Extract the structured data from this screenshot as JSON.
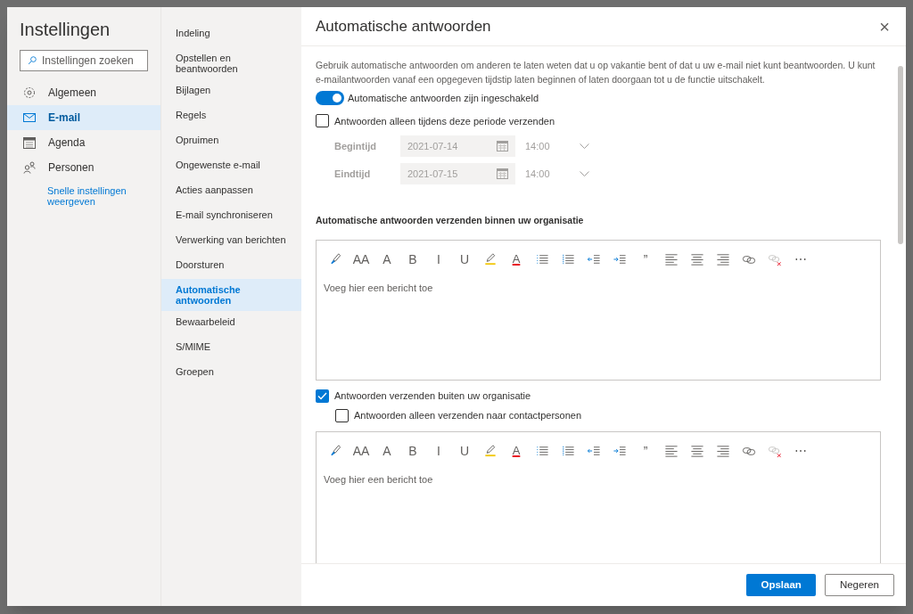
{
  "settings": {
    "title": "Instellingen",
    "search": {
      "placeholder": "Instellingen zoeken"
    },
    "categories": [
      {
        "label": "Algemeen",
        "kind": "gear",
        "selected": false
      },
      {
        "label": "E-mail",
        "kind": "mail",
        "selected": true
      },
      {
        "label": "Agenda",
        "kind": "calendar",
        "selected": false
      },
      {
        "label": "Personen",
        "kind": "people",
        "selected": false
      }
    ],
    "quick_link": "Snelle instellingen weergeven"
  },
  "subnav": [
    {
      "label": "Indeling",
      "selected": false
    },
    {
      "label": "Opstellen en beantwoorden",
      "selected": false
    },
    {
      "label": "Bijlagen",
      "selected": false
    },
    {
      "label": "Regels",
      "selected": false
    },
    {
      "label": "Opruimen",
      "selected": false
    },
    {
      "label": "Ongewenste e-mail",
      "selected": false
    },
    {
      "label": "Acties aanpassen",
      "selected": false
    },
    {
      "label": "E-mail synchroniseren",
      "selected": false
    },
    {
      "label": "Verwerking van berichten",
      "selected": false
    },
    {
      "label": "Doorsturen",
      "selected": false
    },
    {
      "label": "Automatische antwoorden",
      "selected": true
    },
    {
      "label": "Bewaarbeleid",
      "selected": false
    },
    {
      "label": "S/MIME",
      "selected": false
    },
    {
      "label": "Groepen",
      "selected": false
    }
  ],
  "panel": {
    "title": "Automatische antwoorden",
    "close": "×",
    "description": "Gebruik automatische antwoorden om anderen te laten weten dat u op vakantie bent of dat u uw e-mail niet kunt beantwoorden. U kunt e-mailantwoorden vanaf een opgegeven tijdstip laten beginnen of laten doorgaan tot u de functie uitschakelt.",
    "toggle": {
      "label": "Automatische antwoorden zijn ingeschakeld",
      "on": true
    },
    "period": {
      "label": "Antwoorden alleen tijdens deze periode verzenden",
      "checked": false
    },
    "times": [
      {
        "label": "Begintijd",
        "date": "2021-07-14",
        "time": "14:00",
        "disabled": true
      },
      {
        "label": "Eindtijd",
        "date": "2021-07-15",
        "time": "14:00",
        "disabled": true
      }
    ],
    "inside_heading": "Automatische antwoorden verzenden binnen uw organisatie",
    "editors": [
      {
        "placeholder": "Voeg hier een bericht toe",
        "toolbar": [
          {
            "kind": "brush"
          },
          {
            "kind": "glyph",
            "text": "AA"
          },
          {
            "kind": "glyph",
            "text": "A"
          },
          {
            "kind": "glyph",
            "text": "B"
          },
          {
            "kind": "glyph",
            "text": "I"
          },
          {
            "kind": "glyph",
            "text": "U"
          },
          {
            "kind": "highlight"
          },
          {
            "kind": "fontcolor",
            "text": "A"
          },
          {
            "kind": "bullets"
          },
          {
            "kind": "numbering"
          },
          {
            "kind": "outdent"
          },
          {
            "kind": "indent"
          },
          {
            "kind": "glyph",
            "text": "”"
          },
          {
            "kind": "alignleft"
          },
          {
            "kind": "aligncenter"
          },
          {
            "kind": "alignright"
          },
          {
            "kind": "link"
          },
          {
            "kind": "unlink"
          },
          {
            "kind": "glyph",
            "text": "⋯"
          }
        ]
      },
      {
        "placeholder": "Voeg hier een bericht toe",
        "toolbar": [
          {
            "kind": "brush"
          },
          {
            "kind": "glyph",
            "text": "AA"
          },
          {
            "kind": "glyph",
            "text": "A"
          },
          {
            "kind": "glyph",
            "text": "B"
          },
          {
            "kind": "glyph",
            "text": "I"
          },
          {
            "kind": "glyph",
            "text": "U"
          },
          {
            "kind": "highlight"
          },
          {
            "kind": "fontcolor",
            "text": "A"
          },
          {
            "kind": "bullets"
          },
          {
            "kind": "numbering"
          },
          {
            "kind": "outdent"
          },
          {
            "kind": "indent"
          },
          {
            "kind": "glyph",
            "text": "”"
          },
          {
            "kind": "alignleft"
          },
          {
            "kind": "aligncenter"
          },
          {
            "kind": "alignright"
          },
          {
            "kind": "link"
          },
          {
            "kind": "unlink"
          },
          {
            "kind": "glyph",
            "text": "⋯"
          }
        ]
      }
    ],
    "outside": {
      "label": "Antwoorden verzenden buiten uw organisatie",
      "checked": true
    },
    "contacts_only": {
      "label": "Antwoorden alleen verzenden naar contactpersonen",
      "checked": false
    },
    "buttons": [
      {
        "label": "Opslaan",
        "kind": "primary"
      },
      {
        "label": "Negeren",
        "kind": "secondary"
      }
    ]
  }
}
